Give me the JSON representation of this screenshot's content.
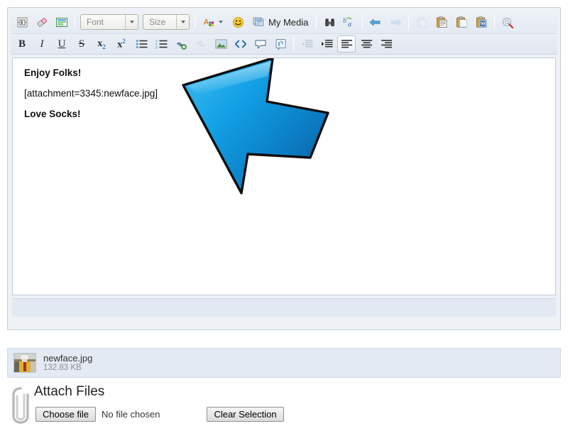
{
  "editor": {
    "toolbar_row1": [
      {
        "name": "source-code-button",
        "icon": "source-code-icon",
        "title": "Source",
        "type": "icon"
      },
      {
        "name": "remove-format-button",
        "icon": "eraser-icon",
        "title": "Remove Format",
        "type": "icon"
      },
      {
        "name": "toggle-editor-button",
        "icon": "toggle-editor-icon",
        "title": "Toggle Editor",
        "type": "icon"
      },
      {
        "name": "font-family-select",
        "icon": "font-select",
        "title": "Font",
        "type": "select",
        "value": "Font"
      },
      {
        "name": "font-size-select",
        "icon": "size-select",
        "title": "Size",
        "type": "select",
        "value": "Size"
      },
      {
        "name": "text-color-button",
        "icon": "text-color-icon",
        "title": "Text Color",
        "type": "icon-split"
      },
      {
        "name": "emoticon-button",
        "icon": "smiley-icon",
        "title": "Emoticons",
        "type": "icon"
      },
      {
        "name": "my-media-button",
        "icon": "my-media-icon",
        "title": "My Media",
        "type": "icon-label",
        "label": "My Media"
      },
      {
        "name": "find-replace-button",
        "icon": "binoculars-icon",
        "title": "Find",
        "type": "icon"
      },
      {
        "name": "translate-button",
        "icon": "translate-icon",
        "title": "Translate",
        "type": "icon"
      },
      {
        "name": "undo-button",
        "icon": "undo-arrow-icon",
        "title": "Undo",
        "type": "icon"
      },
      {
        "name": "redo-button",
        "icon": "redo-arrow-icon",
        "title": "Redo",
        "type": "icon",
        "disabled": true
      },
      {
        "name": "copy-button",
        "icon": "copy-icon",
        "title": "Copy",
        "type": "icon",
        "disabled": true
      },
      {
        "name": "paste-button",
        "icon": "paste-icon",
        "title": "Paste",
        "type": "icon"
      },
      {
        "name": "paste-text-button",
        "icon": "paste-text-icon",
        "title": "Paste as Text",
        "type": "icon"
      },
      {
        "name": "paste-word-button",
        "icon": "paste-word-icon",
        "title": "Paste from Word",
        "type": "icon"
      },
      {
        "name": "spellcheck-button",
        "icon": "spellcheck-icon",
        "title": "Spell Check",
        "type": "icon"
      }
    ],
    "toolbar_row2": [
      {
        "name": "bold-button",
        "icon": "bold-icon",
        "title": "Bold",
        "glyph": "B"
      },
      {
        "name": "italic-button",
        "icon": "italic-icon",
        "title": "Italic",
        "glyph": "I"
      },
      {
        "name": "underline-button",
        "icon": "underline-icon",
        "title": "Underline",
        "glyph": "U"
      },
      {
        "name": "strikethrough-button",
        "icon": "strikethrough-icon",
        "title": "Strikethrough",
        "glyph": "S"
      },
      {
        "name": "subscript-button",
        "icon": "subscript-icon",
        "title": "Subscript",
        "glyph": "x2"
      },
      {
        "name": "superscript-button",
        "icon": "superscript-icon",
        "title": "Superscript",
        "glyph": "x2"
      },
      {
        "name": "bullet-list-button",
        "icon": "bullet-list-icon",
        "title": "Bullet List"
      },
      {
        "name": "numbered-list-button",
        "icon": "numbered-list-icon",
        "title": "Numbered List"
      },
      {
        "name": "insert-link-button",
        "icon": "link-add-icon",
        "title": "Insert Link"
      },
      {
        "name": "remove-link-button",
        "icon": "link-remove-icon",
        "title": "Remove Link",
        "disabled": true
      },
      {
        "name": "insert-image-button",
        "icon": "image-icon",
        "title": "Insert Image"
      },
      {
        "name": "code-button",
        "icon": "code-icon",
        "title": "Code"
      },
      {
        "name": "quote-button",
        "icon": "quote-bubble-icon",
        "title": "Quote"
      },
      {
        "name": "twitter-button",
        "icon": "twitter-icon",
        "title": "Twitter"
      },
      {
        "name": "outdent-button",
        "icon": "outdent-icon",
        "title": "Outdent",
        "disabled": true
      },
      {
        "name": "indent-button",
        "icon": "indent-icon",
        "title": "Indent"
      },
      {
        "name": "align-left-button",
        "icon": "align-left-icon",
        "title": "Align Left",
        "active": true
      },
      {
        "name": "align-center-button",
        "icon": "align-center-icon",
        "title": "Align Center"
      },
      {
        "name": "align-right-button",
        "icon": "align-right-icon",
        "title": "Align Right"
      }
    ],
    "content": {
      "line1": "Enjoy Folks!",
      "line2": "[attachment=3345:newface.jpg]",
      "line3": "Love Socks!"
    },
    "annotation": {
      "name": "blue-arrow-annotation",
      "shape": "arrow-pointing-up-left",
      "fill_light": "#29a8e8",
      "fill_dark": "#0c6fb5",
      "outline": "#111111"
    }
  },
  "attachment": {
    "file_name": "newface.jpg",
    "file_size": "132.83 KB"
  },
  "attach_files": {
    "title": "Attach Files",
    "choose_file_label": "Choose file",
    "no_file_text": "No file chosen",
    "clear_selection_label": "Clear Selection"
  },
  "colors": {
    "toolbar_bg": "#e8edf4",
    "panel_bg": "#e4eaf3",
    "canvas_bg": "#ffffff",
    "border": "#c8d0dc",
    "arrow_blue": "#1896dd"
  }
}
